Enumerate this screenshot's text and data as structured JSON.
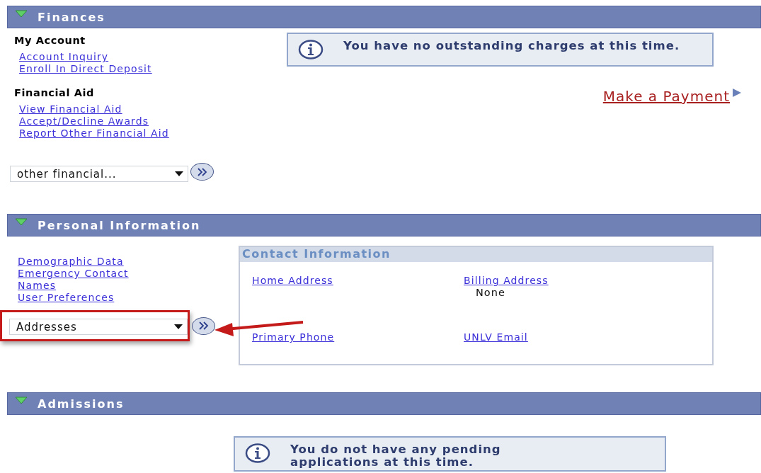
{
  "sections": [
    {
      "kind": "finances",
      "title": "Finances",
      "expanded": true,
      "groups": [
        {
          "heading": "My Account",
          "links": [
            "Account Inquiry",
            "Enroll In Direct Deposit"
          ]
        },
        {
          "heading": "Financial Aid",
          "links": [
            "View Financial Aid",
            "Accept/Decline Awards",
            "Report Other Financial Aid"
          ]
        }
      ],
      "dropdown": {
        "value": "other financial...",
        "highlighted": false
      },
      "message": "You have no outstanding charges at this time.",
      "payment_link": "Make a Payment"
    },
    {
      "kind": "personal",
      "title": "Personal Information",
      "expanded": true,
      "links": [
        "Demographic Data",
        "Emergency Contact",
        "Names",
        "User Preferences"
      ],
      "dropdown": {
        "value": "Addresses",
        "highlighted": true
      },
      "contact": {
        "title": "Contact Information",
        "items": [
          {
            "link": "Home Address"
          },
          {
            "link": "Billing Address",
            "value": "None"
          },
          {
            "link": "Primary Phone"
          },
          {
            "link": "UNLV Email"
          }
        ]
      }
    },
    {
      "kind": "admissions",
      "title": "Admissions",
      "expanded": true,
      "message": "You do not have any pending applications at this time."
    }
  ]
}
